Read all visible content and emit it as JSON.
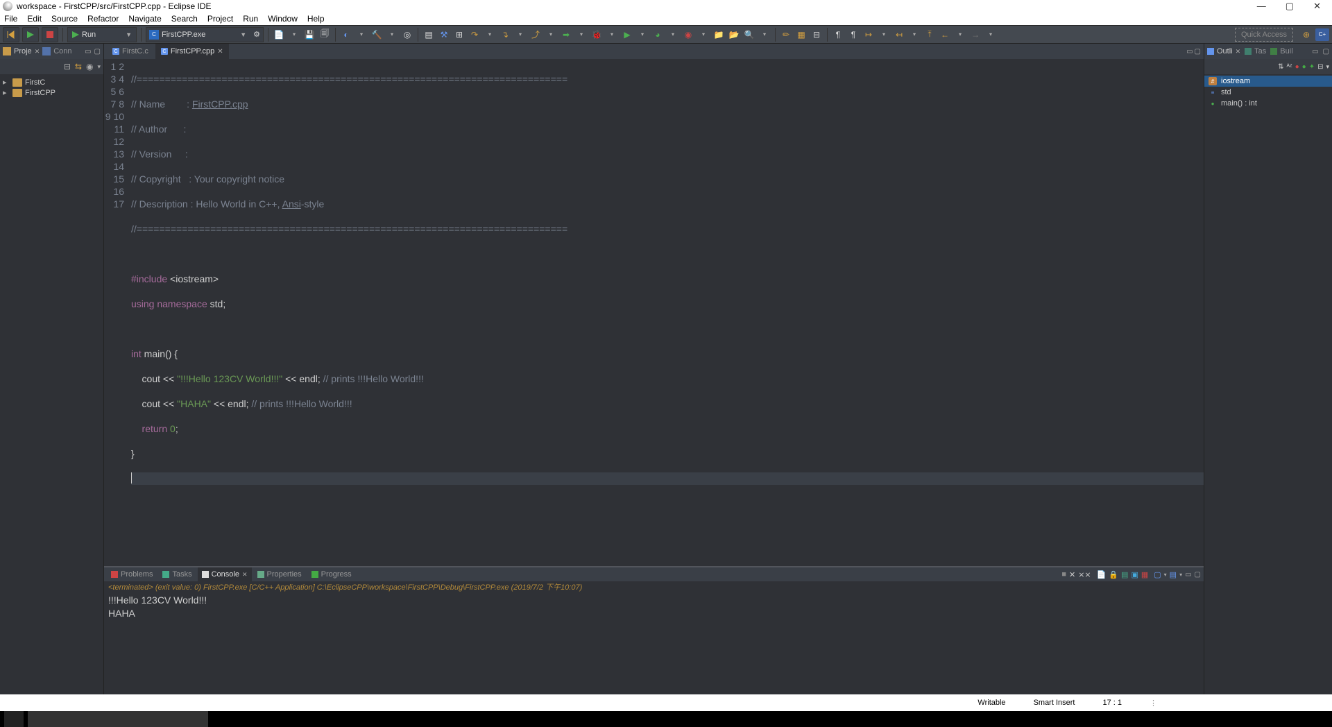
{
  "title": "workspace - FirstCPP/src/FirstCPP.cpp - Eclipse IDE",
  "menus": [
    "File",
    "Edit",
    "Source",
    "Refactor",
    "Navigate",
    "Search",
    "Project",
    "Run",
    "Window",
    "Help"
  ],
  "run_dropdown": "Run",
  "config_dropdown": "FirstCPP.exe",
  "quick_access": "Quick Access",
  "left": {
    "tab1": "Proje",
    "tab2": "Conn",
    "tree": [
      "FirstC",
      "FirstCPP"
    ]
  },
  "editor": {
    "tabs": [
      {
        "label": "FirstC.c",
        "active": false
      },
      {
        "label": "FirstCPP.cpp",
        "active": true
      }
    ],
    "lines": 17
  },
  "code": {
    "l1": "//============================================================================",
    "l2a": "// Name        : ",
    "l2b": "FirstCPP.cpp",
    "l3": "// Author      :",
    "l4": "// Version     :",
    "l5": "// Copyright   : Your copyright notice",
    "l6a": "// Description : Hello World in C++, ",
    "l6b": "Ansi",
    "l6c": "-style",
    "l7": "//============================================================================",
    "l9a": "#include",
    "l9b": " <iostream>",
    "l10a": "using",
    "l10b": " namespace ",
    "l10c": "std",
    "l10d": ";",
    "l12a": "int",
    "l12b": " main() {",
    "l13a": "    cout << ",
    "l13b": "\"!!!Hello 123CV World!!!\"",
    "l13c": " << endl; ",
    "l13d": "// prints !!!Hello World!!!",
    "l14a": "    cout << ",
    "l14b": "\"HAHA\"",
    "l14c": " << endl; ",
    "l14d": "// prints !!!Hello World!!!",
    "l15a": "    return ",
    "l15b": "0",
    "l15c": ";",
    "l16": "}"
  },
  "bottom": {
    "tabs": [
      "Problems",
      "Tasks",
      "Console",
      "Properties",
      "Progress"
    ],
    "info": "<terminated> (exit value: 0) FirstCPP.exe [C/C++ Application] C:\\EclipseCPP\\workspace\\FirstCPP\\Debug\\FirstCPP.exe (2019/7/2 下午10:07)",
    "out1": "!!!Hello 123CV World!!!",
    "out2": "HAHA"
  },
  "right": {
    "tab1": "Outli",
    "tab2": "Tas",
    "tab3": "Buil",
    "items": [
      {
        "icon": "#",
        "color": "#c08040",
        "label": "iostream",
        "sel": true
      },
      {
        "icon": "≡",
        "color": "#6495ed",
        "label": "std",
        "sel": false
      },
      {
        "icon": "●",
        "color": "#4caf50",
        "label": "main() : int",
        "sel": false
      }
    ]
  },
  "status": {
    "writable": "Writable",
    "mode": "Smart Insert",
    "pos": "17 : 1"
  }
}
